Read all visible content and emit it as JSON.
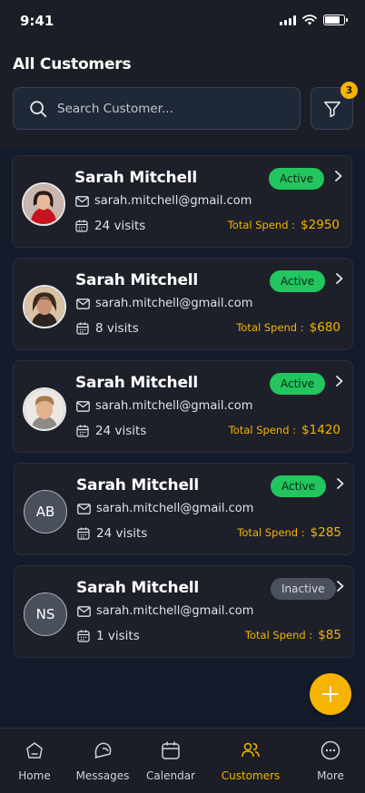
{
  "status_bar": {
    "time": "9:41"
  },
  "header": {
    "title": "All Customers"
  },
  "search": {
    "placeholder": "Search Customer..."
  },
  "filter": {
    "badge_count": "3"
  },
  "customers": [
    {
      "name": "Sarah Mitchell",
      "email": "sarah.mitchell@gmail.com",
      "visits": "24 visits",
      "status": "Active",
      "spend_label": "Total Spend :",
      "spend_amount": "$2950",
      "avatar": "photo"
    },
    {
      "name": "Sarah Mitchell",
      "email": "sarah.mitchell@gmail.com",
      "visits": "8 visits",
      "status": "Active",
      "spend_label": "Total Spend :",
      "spend_amount": "$680",
      "avatar": "photo"
    },
    {
      "name": "Sarah Mitchell",
      "email": "sarah.mitchell@gmail.com",
      "visits": "24 visits",
      "status": "Active",
      "spend_label": "Total Spend :",
      "spend_amount": "$1420",
      "avatar": "photo"
    },
    {
      "name": "Sarah Mitchell",
      "email": "sarah.mitchell@gmail.com",
      "visits": "24 visits",
      "status": "Active",
      "spend_label": "Total Spend :",
      "spend_amount": "$285",
      "avatar": "AB"
    },
    {
      "name": "Sarah Mitchell",
      "email": "sarah.mitchell@gmail.com",
      "visits": "1 visits",
      "status": "Inactive",
      "spend_label": "Total Spend :",
      "spend_amount": "$85",
      "avatar": "NS"
    }
  ],
  "nav": [
    {
      "label": "Home",
      "icon": "home-icon"
    },
    {
      "label": "Messages",
      "icon": "messages-icon"
    },
    {
      "label": "Calendar",
      "icon": "calendar-icon"
    },
    {
      "label": "Customers",
      "icon": "customers-icon",
      "active": true
    },
    {
      "label": "More",
      "icon": "more-icon"
    }
  ],
  "colors": {
    "accent": "#f6b400",
    "active_badge": "#22c55e",
    "inactive_badge": "#4b505d",
    "card": "#1d2029",
    "background": "#141c2b"
  }
}
